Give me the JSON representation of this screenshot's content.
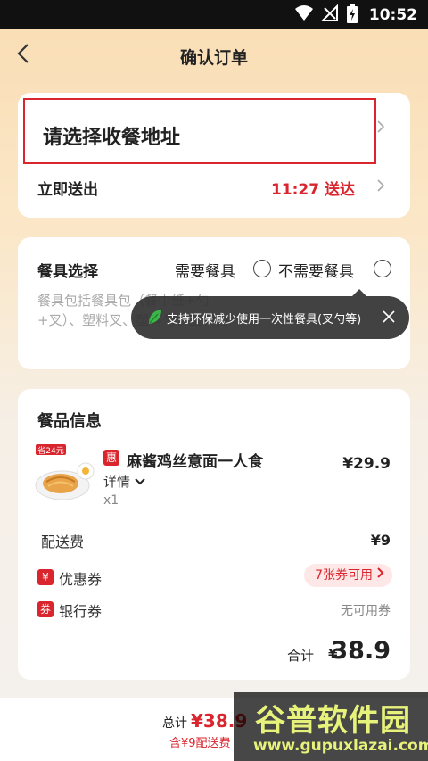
{
  "status_bar": {
    "time": "10:52"
  },
  "header": {
    "title": "确认订单"
  },
  "address": {
    "placeholder": "请选择收餐地址",
    "delivery_label": "立即送出",
    "delivery_time": "11:27 送达"
  },
  "tableware": {
    "title": "餐具选择",
    "option_need": "需要餐具",
    "option_no_need": "不需要餐具",
    "description": "餐具包括餐具包（餐巾纸+勺+叉）、塑料叉、塑料勺、塑料刀",
    "tooltip": "支持环保减少使用一次性餐具(叉勺等)"
  },
  "meal": {
    "title": "餐品信息",
    "item": {
      "promo_tag": "惠",
      "name": "麻酱鸡丝意面一人食",
      "price": "¥29.9",
      "detail": "详情",
      "qty": "x1",
      "image_badge": "省24元"
    },
    "delivery_fee_label": "配送费",
    "delivery_fee": "¥9",
    "coupon": {
      "icon": "¥",
      "label": "优惠券",
      "available": "7张券可用"
    },
    "bank": {
      "icon": "券",
      "label": "银行券",
      "value": "无可用券"
    },
    "total_label": "合计",
    "total_currency": "¥",
    "total_value": "38.9"
  },
  "bottom": {
    "total_label": "总计",
    "total_amount": "¥38.9",
    "sub": "含¥9配送费"
  },
  "watermark": {
    "title": "谷普软件园",
    "url": "www.gupuxlazai.com"
  },
  "colors": {
    "accent": "#d9252e",
    "background": "#f9ddb3"
  },
  "icons": [
    "wifi-icon",
    "signal-icon",
    "battery-icon",
    "back-arrow-icon",
    "chevron-right-icon",
    "leaf-icon",
    "close-icon",
    "chevron-down-icon"
  ]
}
